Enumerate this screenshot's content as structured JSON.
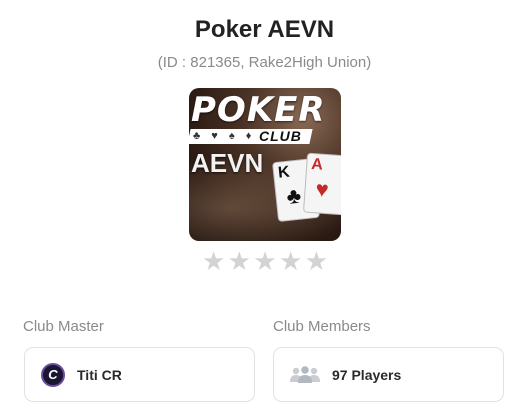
{
  "club": {
    "name": "Poker AEVN",
    "subtitle": "(ID : 821365, Rake2High Union)",
    "logo": {
      "brand_text": "POKER",
      "club_text": "CLUB",
      "suits": "♣ ♥ ♠ ♦",
      "name_text": "AEVN",
      "card1_rank": "K",
      "card1_suit": "♣",
      "card2_rank": "A",
      "card2_suit": "♥"
    },
    "rating": {
      "max": 5,
      "value": 0
    }
  },
  "master": {
    "label": "Club Master",
    "name": "Titi CR",
    "avatar_letter": "C"
  },
  "members": {
    "label": "Club Members",
    "count_text": "97 Players",
    "icon": "group-icon"
  },
  "colors": {
    "star_empty": "#d3d3d3",
    "muted_text": "#8a8a8a"
  }
}
